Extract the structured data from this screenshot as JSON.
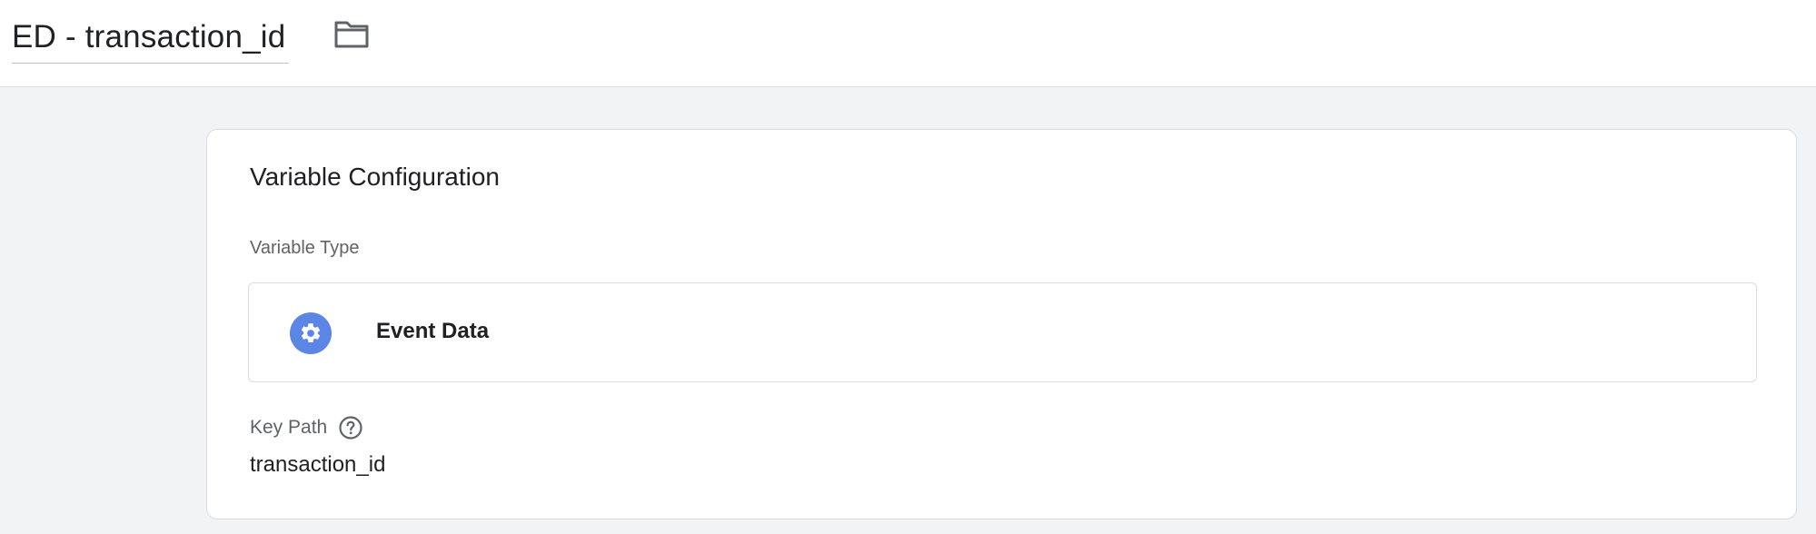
{
  "header": {
    "title": "ED - transaction_id",
    "folder_icon": "folder-icon"
  },
  "card": {
    "title": "Variable Configuration",
    "variable_type": {
      "label": "Variable Type",
      "selected": "Event Data",
      "icon": "gear-icon",
      "icon_color": "#5b86e5"
    },
    "key_path": {
      "label": "Key Path",
      "help_icon": "help-circle-icon",
      "value": "transaction_id"
    }
  },
  "colors": {
    "page_background": "#f1f3f4",
    "card_background": "#ffffff",
    "border": "#dadce0",
    "text_primary": "#202124",
    "text_secondary": "#5f6368"
  }
}
